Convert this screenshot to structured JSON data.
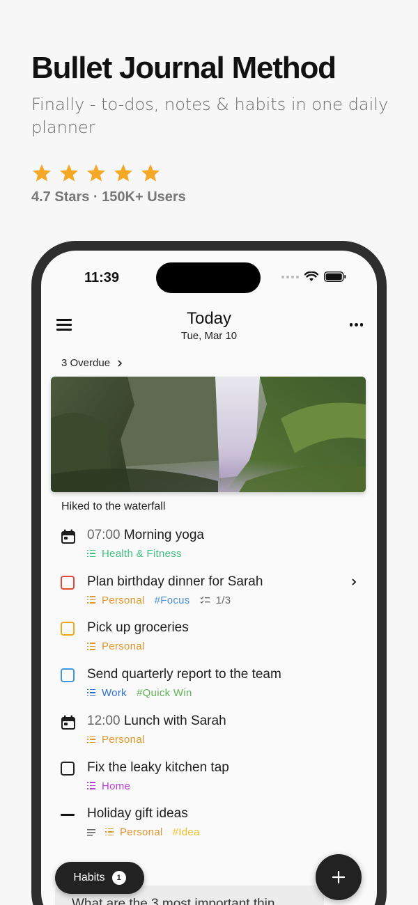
{
  "promo": {
    "title": "Bullet Journal Method",
    "subtitle": "Finally - to-dos, notes & habits in one daily planner",
    "rating_stars": 5,
    "rating_text": "4.7 Stars · 150K+ Users",
    "star_color": "#f4a825"
  },
  "status_bar": {
    "time": "11:39"
  },
  "header": {
    "title": "Today",
    "date": "Tue, Mar 10"
  },
  "overdue": {
    "label": "3 Overdue"
  },
  "photo": {
    "caption": "Hiked to the waterfall"
  },
  "items": [
    {
      "type": "event",
      "time": "07:00",
      "title": "Morning yoga",
      "tags": [
        {
          "label": "Health & Fitness",
          "color": "#3ec17c",
          "kind": "list"
        }
      ]
    },
    {
      "type": "task",
      "title": "Plan birthday dinner for Sarah",
      "checkbox_color": "#e0463a",
      "tags": [
        {
          "label": "Personal",
          "color": "#e0962a",
          "kind": "list"
        },
        {
          "label": "#Focus",
          "color": "#4a8ed8",
          "kind": "hashtag"
        },
        {
          "label": "1/3",
          "color": "#666666",
          "kind": "subtasks"
        }
      ]
    },
    {
      "type": "task",
      "title": "Pick up groceries",
      "checkbox_color": "#f0a81e",
      "tags": [
        {
          "label": "Personal",
          "color": "#e0962a",
          "kind": "list"
        }
      ]
    },
    {
      "type": "task",
      "title": "Send quarterly report to the team",
      "checkbox_color": "#3a97e8",
      "tags": [
        {
          "label": "Work",
          "color": "#2c6fcf",
          "kind": "list"
        },
        {
          "label": "#Quick Win",
          "color": "#5fb157",
          "kind": "hashtag"
        }
      ]
    },
    {
      "type": "event",
      "time": "12:00",
      "title": "Lunch with Sarah",
      "tags": [
        {
          "label": "Personal",
          "color": "#e0962a",
          "kind": "list"
        }
      ]
    },
    {
      "type": "task",
      "title": "Fix the leaky kitchen tap",
      "checkbox_color": "#222222",
      "tags": [
        {
          "label": "Home",
          "color": "#b63ad6",
          "kind": "list"
        }
      ]
    },
    {
      "type": "note",
      "title": "Holiday gift ideas",
      "tags": [
        {
          "label": "",
          "color": "#666666",
          "kind": "note"
        },
        {
          "label": "Personal",
          "color": "#e0962a",
          "kind": "list"
        },
        {
          "label": "#Idea",
          "color": "#f0c020",
          "kind": "hashtag"
        }
      ]
    }
  ],
  "habits": {
    "label": "Habits",
    "count": "1"
  },
  "prompt": {
    "text": "What are the 3 most important thin"
  },
  "fab_icon": "plus-icon"
}
